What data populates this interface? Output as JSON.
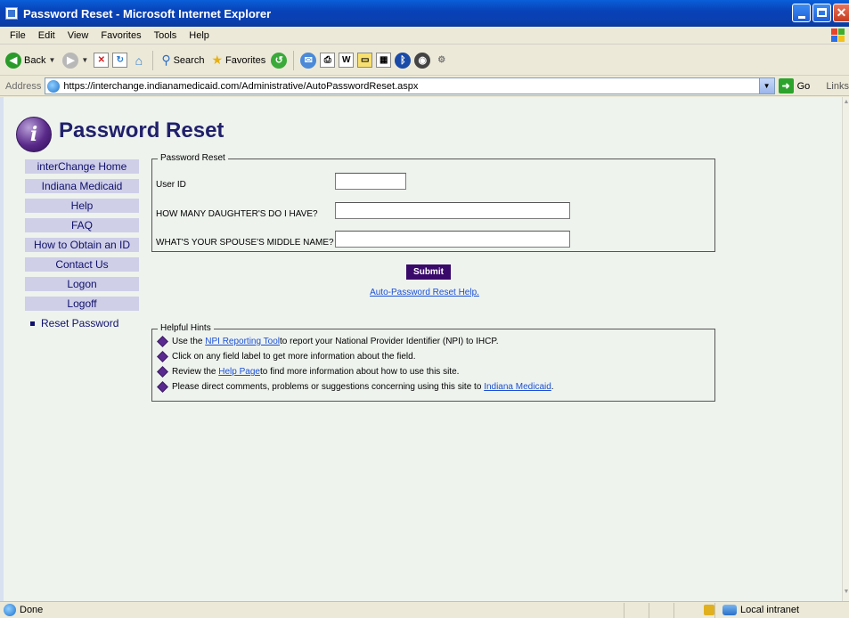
{
  "window": {
    "title": "Password Reset - Microsoft Internet Explorer"
  },
  "menu": [
    "File",
    "Edit",
    "View",
    "Favorites",
    "Tools",
    "Help"
  ],
  "toolbar": {
    "back_label": "Back",
    "search_label": "Search",
    "favorites_label": "Favorites"
  },
  "address": {
    "label": "Address",
    "url": "https://interchange.indianamedicaid.com/Administrative/AutoPasswordReset.aspx",
    "go_label": "Go",
    "links_label": "Links"
  },
  "page": {
    "title": "Password Reset",
    "logo_glyph": "i"
  },
  "sidebar": {
    "items": [
      {
        "label": "interChange Home"
      },
      {
        "label": "Indiana Medicaid"
      },
      {
        "label": "Help"
      },
      {
        "label": "FAQ"
      },
      {
        "label": "How to Obtain an ID"
      },
      {
        "label": "Contact Us"
      },
      {
        "label": "Logon"
      },
      {
        "label": "Logoff"
      },
      {
        "label": "Reset Password"
      }
    ]
  },
  "form": {
    "legend": "Password Reset",
    "user_id_label": "User ID",
    "user_id_value": "",
    "question1_label": "HOW MANY DAUGHTER'S DO I HAVE?",
    "question1_value": "",
    "question2_label": "WHAT'S YOUR SPOUSE'S MIDDLE NAME?",
    "question2_value": "",
    "submit_label": "Submit",
    "help_link": "Auto-Password Reset Help."
  },
  "hints": {
    "legend": "Helpful Hints",
    "h1_pre": "Use the ",
    "h1_link": "NPI Reporting Tool ",
    "h1_post": "to report your National Provider Identifier (NPI) to IHCP.",
    "h2": "Click on any field label to get more information about  the field.",
    "h3_pre": "Review the ",
    "h3_link": "Help Page",
    "h3_post": " to find more information about how to use this site.",
    "h4_pre": "Please direct comments, problems or suggestions concerning using this site to ",
    "h4_link": "Indiana Medicaid",
    "h4_post": "."
  },
  "status": {
    "text": "Done",
    "zone": "Local intranet"
  },
  "colors": {
    "brand_purple": "#3a0a6a",
    "nav_bg": "#cfcfe8",
    "page_bg": "#eef3ee"
  }
}
